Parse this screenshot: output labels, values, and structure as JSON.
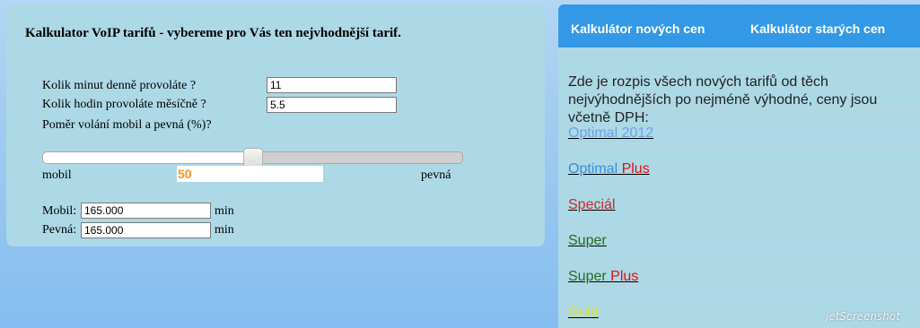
{
  "calculator": {
    "title": "Kalkulator VoIP tarifů - vybereme pro Vás ten nejvhodnější tarif.",
    "minutes_label": "Kolik minut denně provoláte ?",
    "minutes_value": "11",
    "hours_label": "Kolik hodin provoláte měsíčně ?",
    "hours_value": "5.5",
    "ratio_label": "Poměr volání mobil a pevná (%)?",
    "slider": {
      "value": 50,
      "min": 0,
      "max": 100,
      "left_label": "mobil",
      "right_label": "pevná",
      "display": "50"
    },
    "mobil_label": "Mobil:",
    "mobil_value": "165.000",
    "pevna_label": "Pevná:",
    "pevna_value": "165.000",
    "unit": "min"
  },
  "tabs": [
    "Kalkulátor nových cen",
    "Kalkulátor starých cen"
  ],
  "intro": "Zde je rozpis všech nových tarifů od těch nejvýhodnějších po nejméně výhodné, ceny jsou včetně DPH:",
  "tariffs": [
    {
      "parts": [
        {
          "text": "Optimal 2012",
          "color": "#6fa3e0"
        }
      ]
    },
    {
      "parts": [
        {
          "text": "Optimal ",
          "color": "#3a8fd8"
        },
        {
          "text": "Plus",
          "color": "#e01010"
        }
      ]
    },
    {
      "parts": [
        {
          "text": "Speciál",
          "color": "#c03030"
        }
      ]
    },
    {
      "parts": [
        {
          "text": "Super",
          "color": "#2e6b1e"
        }
      ]
    },
    {
      "parts": [
        {
          "text": "Super ",
          "color": "#2e6b1e"
        },
        {
          "text": "Plus",
          "color": "#e01010"
        }
      ]
    },
    {
      "parts": [
        {
          "text": "Gold",
          "color": "#e8e020"
        }
      ]
    }
  ],
  "watermark": "jetScreenshot"
}
